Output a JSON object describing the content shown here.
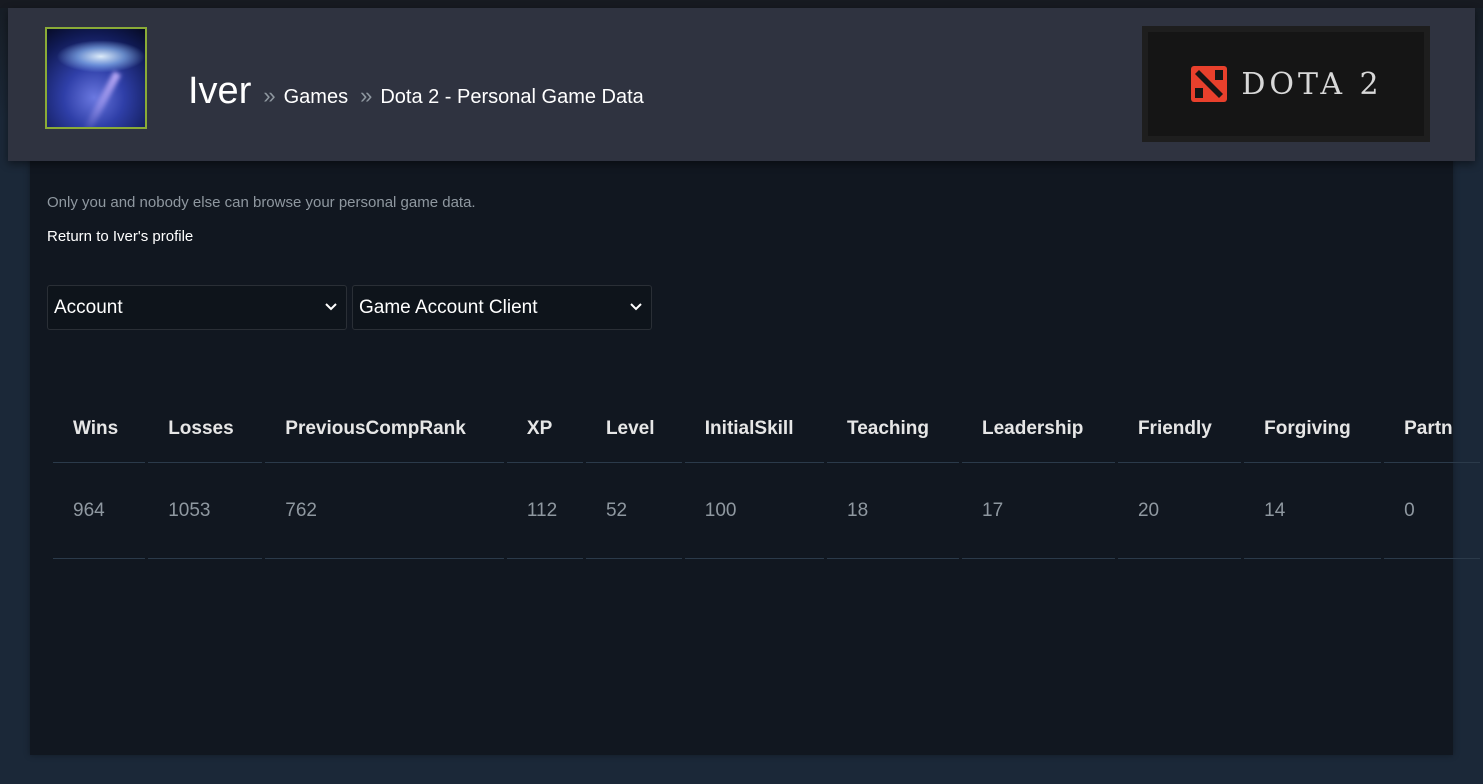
{
  "header": {
    "username": "Iver",
    "separator": "»",
    "crumb_games": "Games",
    "crumb_page": "Dota 2 - Personal Game Data",
    "logo_text": "DOTA 2"
  },
  "intro": {
    "privacy_note": "Only you and nobody else can browse your personal game data.",
    "return_link": "Return to Iver's profile"
  },
  "filters": {
    "category_selected": "Account",
    "subcategory_selected": "Game Account Client"
  },
  "table": {
    "columns": [
      "Wins",
      "Losses",
      "PreviousCompRank",
      "XP",
      "Level",
      "InitialSkill",
      "Teaching",
      "Leadership",
      "Friendly",
      "Forgiving",
      "Partn"
    ],
    "rows": [
      [
        "964",
        "1053",
        "762",
        "112",
        "52",
        "100",
        "18",
        "17",
        "20",
        "14",
        "0"
      ]
    ]
  },
  "colors": {
    "background": "#1b2838",
    "header_bar": "#2f3340",
    "panel": "#111720",
    "avatar_border": "#8aab37",
    "muted_text": "#8f98a0",
    "dota_red": "#e8402c"
  }
}
